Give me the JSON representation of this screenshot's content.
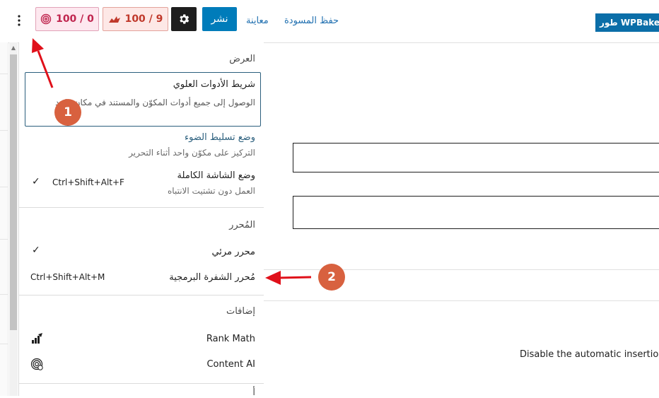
{
  "topbar": {
    "options_icon": "vertical-ellipsis-icon",
    "seo_score": "100 / 0",
    "readability_score": "100 / 9",
    "publish_label": "نشر",
    "preview_label": "معاينة",
    "save_draft_label": "حفظ المسودة",
    "wpbakery_label": "طور WPBakery"
  },
  "menu": {
    "view_heading": "العرض",
    "top_toolbar": {
      "title": "شريط الأدوات العلوي",
      "description": "الوصول إلى جميع أدوات المكوّن والمستند في مكان واحد"
    },
    "spotlight": {
      "title": "وضع تسليط الضوء",
      "description": "التركيز على مكوّن واحد أثناء التحرير"
    },
    "fullscreen": {
      "title": "وضع الشاشة الكاملة",
      "description": "العمل دون تشتيت الانتباه",
      "shortcut": "Ctrl+Shift+Alt+F"
    },
    "editor_heading": "المُحرر",
    "visual_editor": {
      "title": "محرر مرئي"
    },
    "code_editor": {
      "title": "مُحرر الشفرة البرمجية",
      "shortcut": "Ctrl+Shift+Alt+M"
    },
    "plugins_heading": "إضافات",
    "rank_math": {
      "title": "Rank Math"
    },
    "content_ai": {
      "title": "Content AI"
    },
    "next_heading": "أ"
  },
  "content": {
    "disable_text": "Disable the automatic insertion."
  },
  "annotations": {
    "badge_1": "1",
    "badge_2": "2"
  },
  "colors": {
    "primary": "#007cba",
    "annotation": "#d8613f",
    "arrow": "#e0101a"
  }
}
